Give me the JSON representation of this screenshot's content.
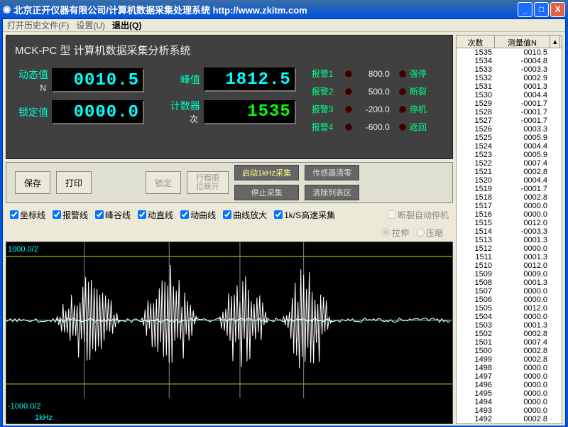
{
  "window": {
    "title": "北京正开仪器有限公司/计算机数据采集处理系统 http://www.zkitm.com"
  },
  "menu": {
    "openHistory": "打开历史文件(F)",
    "settings": "设置(U)",
    "exit": "退出(Q)"
  },
  "header": {
    "title": "MCK-PC 型 计算机数据采集分析系统"
  },
  "readouts": {
    "dynamic": {
      "label": "动态值",
      "unit": "N",
      "value": "0010.5"
    },
    "peak": {
      "label": "峰值",
      "value": "1812.5"
    },
    "locked": {
      "label": "锁定值",
      "value": "0000.0"
    },
    "counter": {
      "label": "计数器",
      "unit": "次",
      "value": "1535"
    }
  },
  "alarms": [
    {
      "label": "报警1",
      "value": "800.0",
      "action": "强停"
    },
    {
      "label": "报警2",
      "value": "500.0",
      "action": "断裂"
    },
    {
      "label": "报警3",
      "value": "-200.0",
      "action": "停机"
    },
    {
      "label": "报警4",
      "value": "-600.0",
      "action": "返回"
    }
  ],
  "buttons": {
    "save": "保存",
    "print": "打印",
    "lock": "锁定",
    "travelLimit": "行程限\n位断开",
    "start": "启动1kHz采集",
    "stop": "停止采集",
    "sensorZero": "传感器清零",
    "clearList": "清除列表区"
  },
  "checks": {
    "coord": "坐标线",
    "alarm": "报警线",
    "peakvalley": "峰谷线",
    "straight": "动直线",
    "curve": "动曲线",
    "zoom": "曲线放大",
    "highspeed": "1k/S高速采集",
    "autostop": "断裂自动停机",
    "stretch": "拉伸",
    "compress": "压缩"
  },
  "graph": {
    "ytop": "1000.0/2",
    "ybot": "-1000.0/2",
    "xlabel": "1kHz"
  },
  "table": {
    "h1": "次数",
    "h2": "测量值N",
    "rows": [
      {
        "n": "1535",
        "v": "0010.5"
      },
      {
        "n": "1534",
        "v": "-0004.8"
      },
      {
        "n": "1533",
        "v": "-0003.3"
      },
      {
        "n": "1532",
        "v": "0002.9"
      },
      {
        "n": "1531",
        "v": "0001.3"
      },
      {
        "n": "1530",
        "v": "0004.4"
      },
      {
        "n": "1529",
        "v": "-0001.7"
      },
      {
        "n": "1528",
        "v": "-0001.7"
      },
      {
        "n": "1527",
        "v": "-0001.7"
      },
      {
        "n": "1526",
        "v": "0003.3"
      },
      {
        "n": "1525",
        "v": "0005.9"
      },
      {
        "n": "1524",
        "v": "0004.4"
      },
      {
        "n": "1523",
        "v": "0005.9"
      },
      {
        "n": "1522",
        "v": "0007.4"
      },
      {
        "n": "1521",
        "v": "0002.8"
      },
      {
        "n": "1520",
        "v": "0004.4"
      },
      {
        "n": "1519",
        "v": "-0001.7"
      },
      {
        "n": "1518",
        "v": "0002.8"
      },
      {
        "n": "1517",
        "v": "0000.0"
      },
      {
        "n": "1516",
        "v": "0000.0"
      },
      {
        "n": "1515",
        "v": "0012.0"
      },
      {
        "n": "1514",
        "v": "-0003.3"
      },
      {
        "n": "1513",
        "v": "0001.3"
      },
      {
        "n": "1512",
        "v": "0000.0"
      },
      {
        "n": "1511",
        "v": "0001.3"
      },
      {
        "n": "1510",
        "v": "0012.0"
      },
      {
        "n": "1509",
        "v": "0009.0"
      },
      {
        "n": "1508",
        "v": "0001.3"
      },
      {
        "n": "1507",
        "v": "0000.0"
      },
      {
        "n": "1506",
        "v": "0000.0"
      },
      {
        "n": "1505",
        "v": "0012.0"
      },
      {
        "n": "1504",
        "v": "0000.0"
      },
      {
        "n": "1503",
        "v": "0001.3"
      },
      {
        "n": "1502",
        "v": "0002.8"
      },
      {
        "n": "1501",
        "v": "0007.4"
      },
      {
        "n": "1500",
        "v": "0002.8"
      },
      {
        "n": "1499",
        "v": "0002.8"
      },
      {
        "n": "1498",
        "v": "0000.0"
      },
      {
        "n": "1497",
        "v": "0000.0"
      },
      {
        "n": "1496",
        "v": "0000.0"
      },
      {
        "n": "1495",
        "v": "0000.0"
      },
      {
        "n": "1494",
        "v": "0000.0"
      },
      {
        "n": "1493",
        "v": "0000.0"
      },
      {
        "n": "1492",
        "v": "0002.8"
      }
    ]
  }
}
